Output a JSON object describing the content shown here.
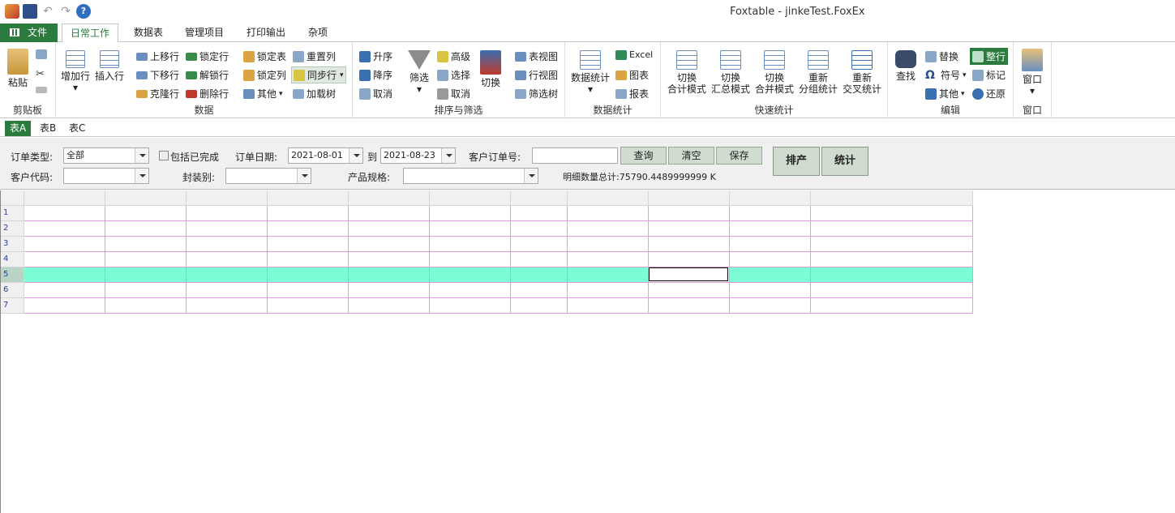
{
  "window": {
    "title": "Foxtable - jinkeTest.FoxEx"
  },
  "menu_tabs": [
    "文件",
    "日常工作",
    "数据表",
    "管理项目",
    "打印输出",
    "杂项"
  ],
  "ribbon": {
    "clipboard": {
      "paste": "粘贴",
      "label": "剪贴板"
    },
    "data": {
      "add_row": "增加行",
      "insert_row": "插入行",
      "move_up": "上移行",
      "move_down": "下移行",
      "clone_row": "克隆行",
      "lock_row": "锁定行",
      "unlock_row": "解锁行",
      "delete_row": "删除行",
      "lock_table": "锁定表",
      "lock_col": "锁定列",
      "other": "其他",
      "reset_col": "重置列",
      "sync_row": "同步行",
      "load_tree": "加载树",
      "label": "数据"
    },
    "sort": {
      "asc": "升序",
      "desc": "降序",
      "cancel": "取消",
      "filter": "筛选",
      "advanced": "高级",
      "select": "选择",
      "cancel2": "取消",
      "toggle": "切换",
      "label": "排序与筛选"
    },
    "views": {
      "table_view": "表视图",
      "row_view": "行视图",
      "filter_tree": "筛选树"
    },
    "stats": {
      "data_stats": "数据统计",
      "excel": "Excel",
      "chart": "图表",
      "report": "报表",
      "label": "数据统计"
    },
    "quick": {
      "b1": [
        "切换",
        "合计模式"
      ],
      "b2": [
        "切换",
        "汇总模式"
      ],
      "b3": [
        "切换",
        "合并模式"
      ],
      "b4": [
        "重新",
        "分组统计"
      ],
      "b5": [
        "重新",
        "交叉统计"
      ],
      "label": "快速统计"
    },
    "edit": {
      "find": "查找",
      "replace": "替换",
      "symbol": "符号",
      "other": "其他",
      "whole_row": "整行",
      "mark": "标记",
      "restore": "还原",
      "label": "编辑"
    },
    "window": {
      "window": "窗口",
      "label": "窗口"
    }
  },
  "sheet_tabs": [
    "表A",
    "表B",
    "表C"
  ],
  "panel": {
    "order_type_label": "订单类型:",
    "order_type_value": "全部",
    "include_done": "包括已完成",
    "order_date_label": "订单日期:",
    "date_from": "2021-08-01",
    "to": "到",
    "date_to": "2021-08-23",
    "cust_order_label": "客户订单号:",
    "cust_order_value": "",
    "query": "查询",
    "clear": "清空",
    "save": "保存",
    "schedule": "排产",
    "stats": "统计",
    "cust_code_label": "客户代码:",
    "package_label": "封装别:",
    "spec_label": "产品规格:",
    "detail_total": "明细数量总计:75790.4489999999 K"
  },
  "grid": {
    "rows": [
      "1",
      "2",
      "3",
      "4",
      "5",
      "6",
      "7"
    ],
    "current_row": "5"
  },
  "colors": {
    "accent": "#2d7a3e",
    "current_row": "#7cfcd4",
    "grid_line": "#e39ae3"
  }
}
